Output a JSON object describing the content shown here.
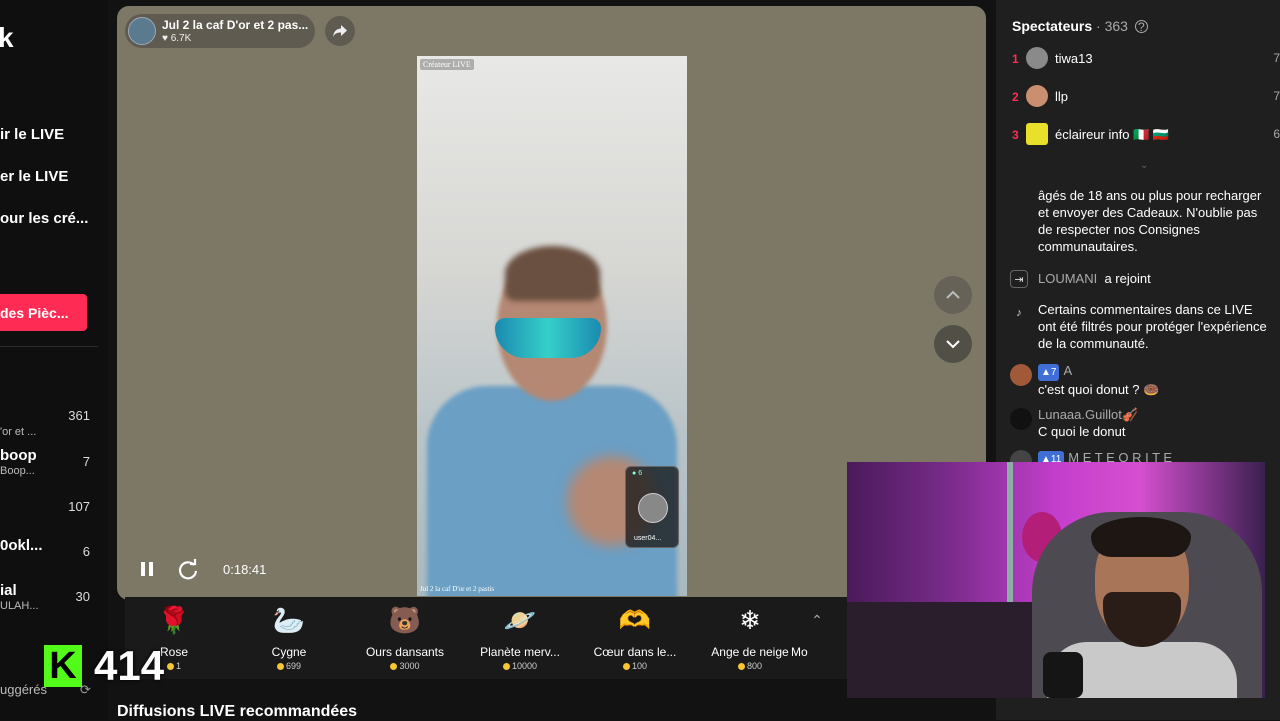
{
  "sidebar": {
    "logo": "k",
    "links": [
      "ir le LIVE",
      "er le LIVE",
      "our les cré..."
    ],
    "pink_button": "des Pièc...",
    "rows": [
      {
        "title": "",
        "sub": "'or et ...",
        "count": "361"
      },
      {
        "title": "boop",
        "sub": "Boop...",
        "count": "7"
      },
      {
        "title": "",
        "sub": "",
        "count": "107"
      },
      {
        "title": "0okl...",
        "sub": "",
        "count": "6"
      },
      {
        "title": "ial",
        "sub": "ULAH...",
        "count": "30"
      }
    ],
    "suggested": "uggérés"
  },
  "kick": {
    "logo": "K",
    "count": "414"
  },
  "stream": {
    "title": "Jul 2 la caf D'or et 2 pas...",
    "likes": "6.7K",
    "creator_tag": "Créateur LIVE",
    "caption": "Jul 2 la caf D'or et 2 pastis",
    "guest_count": "6",
    "guest_name": "user04...",
    "time": "0:18:41"
  },
  "gifts": [
    {
      "name": "Rose",
      "price": "1",
      "icon": "🌹"
    },
    {
      "name": "Cygne",
      "price": "699",
      "icon": "🦢"
    },
    {
      "name": "Ours dansants",
      "price": "3000",
      "icon": "🐻"
    },
    {
      "name": "Planète merv...",
      "price": "10000",
      "icon": "🪐"
    },
    {
      "name": "Cœur dans le...",
      "price": "100",
      "icon": "🫶"
    },
    {
      "name": "Ange de neige",
      "price": "800",
      "icon": "❄"
    },
    {
      "name": "Mo",
      "price": "",
      "icon": "⌃"
    }
  ],
  "recommended_title": "Diffusions LIVE recommandées",
  "viewers": {
    "label": "Spectateurs",
    "count": "363",
    "list": [
      {
        "rank": "1",
        "name": "tiwa13",
        "edge": "7",
        "color": "#8a8a8a"
      },
      {
        "rank": "2",
        "name": "llp",
        "edge": "7",
        "color": "#c98f6f"
      },
      {
        "rank": "3",
        "name": "éclaireur info 🇮🇹 🇧🇬",
        "edge": "6",
        "color": "#e8e02a"
      }
    ]
  },
  "chat": {
    "notice": "âgés de 18 ans ou plus pour recharger et envoyer des Cadeaux. N'oublie pas de respecter nos Consignes communautaires.",
    "join_user": "LOUMANI",
    "join_text": "a rejoint",
    "filter_notice": "Certains commentaires dans ce LIVE ont été filtrés pour protéger l'expérience de la communauté.",
    "messages": [
      {
        "badge": "7",
        "user": "A",
        "text": "c'est quoi donut ? 🍩"
      },
      {
        "badge": "",
        "user": "Lunaaa.Guillot🎻",
        "text": "C quoi le donut"
      },
      {
        "badge": "11",
        "user": "M E T E O R I T E",
        "text": ""
      }
    ]
  }
}
